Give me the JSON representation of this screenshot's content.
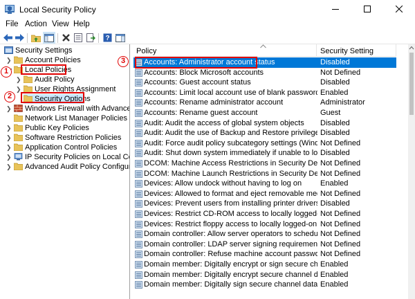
{
  "window": {
    "title": "Local Security Policy"
  },
  "menu": [
    "File",
    "Action",
    "View",
    "Help"
  ],
  "tree": {
    "root": "Security Settings",
    "items": [
      {
        "label": "Account Policies"
      },
      {
        "label": "Local Policies"
      },
      {
        "label": "Audit Policy"
      },
      {
        "label": "User Rights Assignment"
      },
      {
        "label": "Security Options"
      },
      {
        "label": "Windows Firewall with Advanced Secu"
      },
      {
        "label": "Network List Manager Policies"
      },
      {
        "label": "Public Key Policies"
      },
      {
        "label": "Software Restriction Policies"
      },
      {
        "label": "Application Control Policies"
      },
      {
        "label": "IP Security Policies on Local Compute"
      },
      {
        "label": "Advanced Audit Policy Configuration"
      }
    ]
  },
  "list": {
    "columns": {
      "policy": "Policy",
      "setting": "Security Setting"
    },
    "rows": [
      {
        "policy": "Accounts: Administrator account status",
        "setting": "Disabled"
      },
      {
        "policy": "Accounts: Block Microsoft accounts",
        "setting": "Not Defined"
      },
      {
        "policy": "Accounts: Guest account status",
        "setting": "Disabled"
      },
      {
        "policy": "Accounts: Limit local account use of blank passwords to co...",
        "setting": "Enabled"
      },
      {
        "policy": "Accounts: Rename administrator account",
        "setting": "Administrator"
      },
      {
        "policy": "Accounts: Rename guest account",
        "setting": "Guest"
      },
      {
        "policy": "Audit: Audit the access of global system objects",
        "setting": "Disabled"
      },
      {
        "policy": "Audit: Audit the use of Backup and Restore privilege",
        "setting": "Disabled"
      },
      {
        "policy": "Audit: Force audit policy subcategory settings (Windows Vis...",
        "setting": "Not Defined"
      },
      {
        "policy": "Audit: Shut down system immediately if unable to log secur...",
        "setting": "Disabled"
      },
      {
        "policy": "DCOM: Machine Access Restrictions in Security Descriptor D...",
        "setting": "Not Defined"
      },
      {
        "policy": "DCOM: Machine Launch Restrictions in Security Descriptor ...",
        "setting": "Not Defined"
      },
      {
        "policy": "Devices: Allow undock without having to log on",
        "setting": "Enabled"
      },
      {
        "policy": "Devices: Allowed to format and eject removable media",
        "setting": "Not Defined"
      },
      {
        "policy": "Devices: Prevent users from installing printer drivers",
        "setting": "Disabled"
      },
      {
        "policy": "Devices: Restrict CD-ROM access to locally logged-on user ...",
        "setting": "Not Defined"
      },
      {
        "policy": "Devices: Restrict floppy access to locally logged-on user only",
        "setting": "Not Defined"
      },
      {
        "policy": "Domain controller: Allow server operators to schedule tasks",
        "setting": "Not Defined"
      },
      {
        "policy": "Domain controller: LDAP server signing requirements",
        "setting": "Not Defined"
      },
      {
        "policy": "Domain controller: Refuse machine account password chan...",
        "setting": "Not Defined"
      },
      {
        "policy": "Domain member: Digitally encrypt or sign secure channel d...",
        "setting": "Enabled"
      },
      {
        "policy": "Domain member: Digitally encrypt secure channel data (wh...",
        "setting": "Enabled"
      },
      {
        "policy": "Domain member: Digitally sign secure channel data (when ...",
        "setting": "Enabled"
      }
    ]
  },
  "annotations": [
    "1",
    "2",
    "3"
  ],
  "colors": {
    "selection": "#0078d7",
    "annotation": "#e00000",
    "folder": "#e8c35a"
  }
}
